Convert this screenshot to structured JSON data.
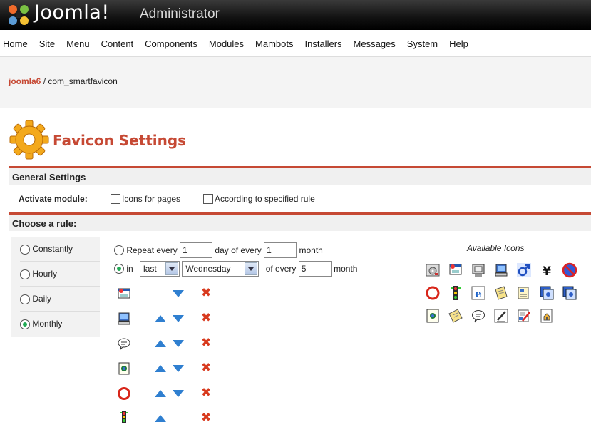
{
  "header": {
    "logo_text": "Joomla!",
    "admin_text": "Administrator"
  },
  "menu": [
    "Home",
    "Site",
    "Menu",
    "Content",
    "Components",
    "Modules",
    "Mambots",
    "Installers",
    "Messages",
    "System",
    "Help"
  ],
  "breadcrumb": {
    "site": "joomla6",
    "separator": " / ",
    "component": "com_smartfavicon"
  },
  "page_title": "Favicon Settings",
  "general": {
    "heading": "General Settings",
    "activate_label": "Activate module:",
    "icons_for_pages": "Icons for pages",
    "according_rule": "According to specified rule"
  },
  "rule": {
    "heading": "Choose a rule:",
    "options": [
      "Constantly",
      "Hourly",
      "Daily",
      "Monthly"
    ],
    "selected": "Monthly",
    "repeat_every": "Repeat every",
    "repeat_day_value": "1",
    "day_of_every": "day of every",
    "repeat_month_value": "1",
    "month": "month",
    "in_label": "in",
    "ordinal_value": "last",
    "weekday_value": "Wednesday",
    "of_every": "of every",
    "in_month_value": "5",
    "month2": "month"
  },
  "available_icons_title": "Available Icons"
}
